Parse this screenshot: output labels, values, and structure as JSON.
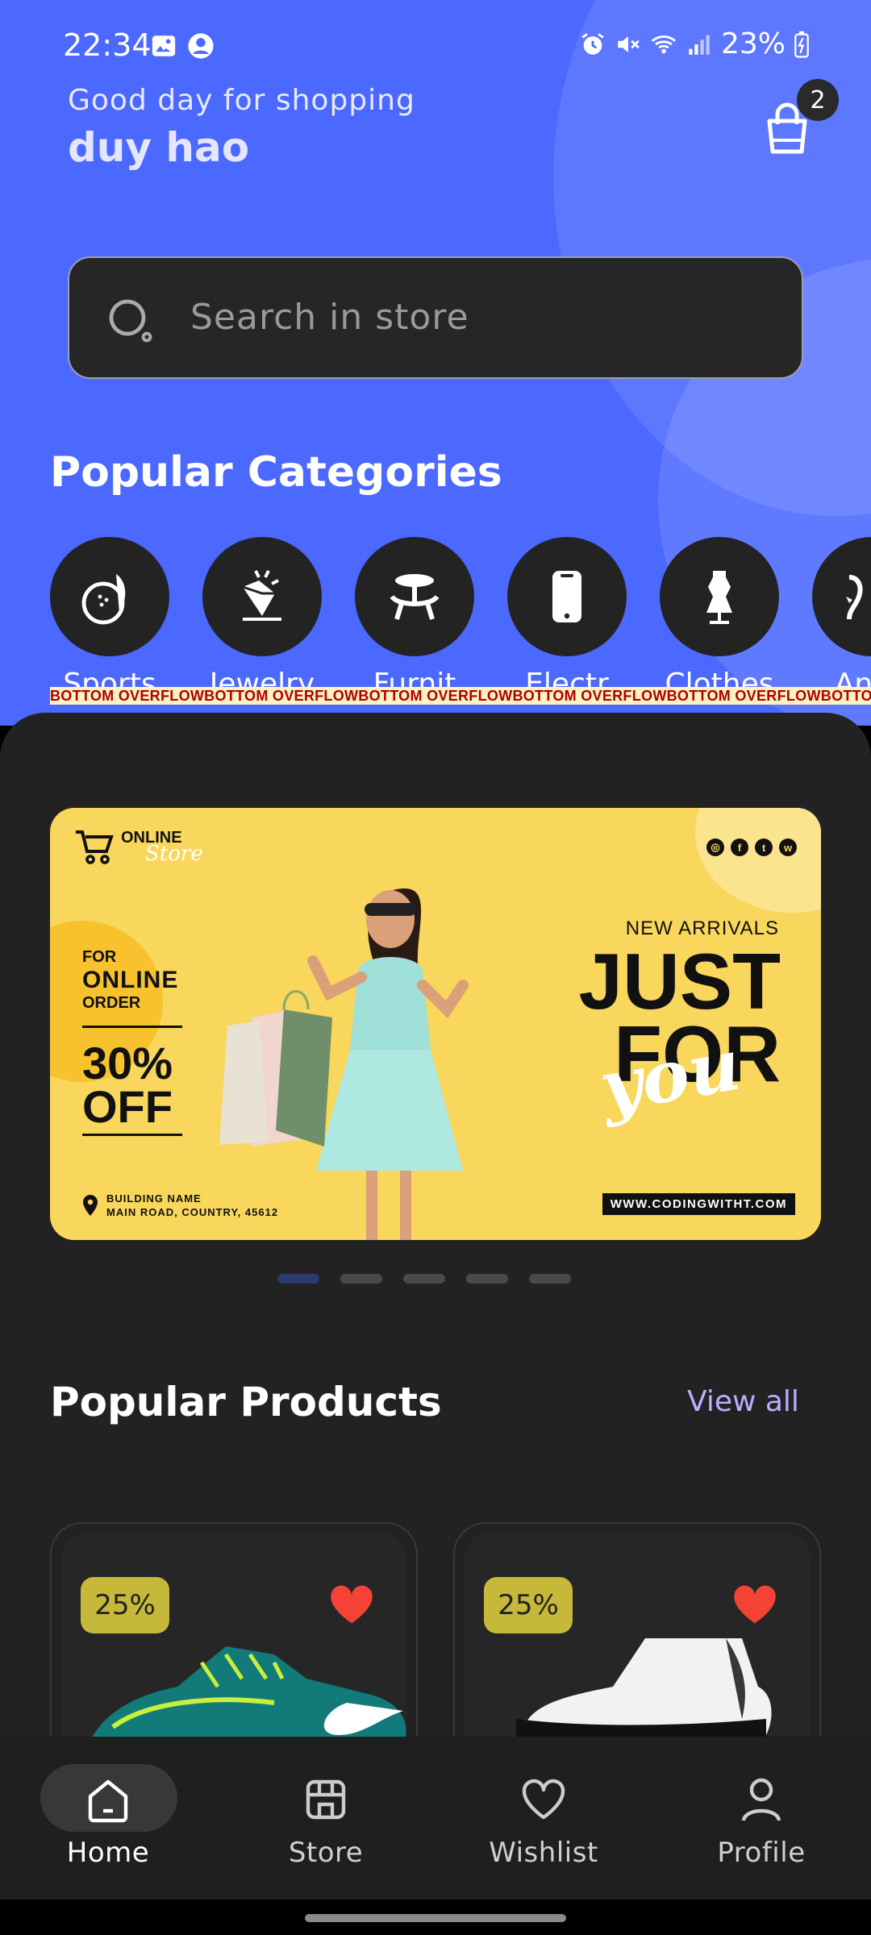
{
  "status_bar": {
    "time": "22:34",
    "battery": "23%"
  },
  "header": {
    "greeting": "Good day for shopping",
    "username": "duy hao",
    "cart_count": "2"
  },
  "search": {
    "placeholder": "Search in store"
  },
  "categories": {
    "title": "Popular Categories",
    "items": [
      {
        "label": "Sports",
        "icon": "sports-icon"
      },
      {
        "label": "Jewelry",
        "icon": "jewelry-icon"
      },
      {
        "label": "Furnit",
        "icon": "furniture-icon"
      },
      {
        "label": "Electr",
        "icon": "electronics-icon"
      },
      {
        "label": "Clothes",
        "icon": "clothes-icon"
      },
      {
        "label": "Anim",
        "icon": "animals-icon"
      }
    ],
    "overflow_warning": "BOTTOM OVERFLOWBOTTOM OVERFLOWBOTTOM OVERFLOWBOTTOM OVERFLOWBOTTOM OVERFLOWBOTTOM OVERFLOWBOTTOM OVERFLOW"
  },
  "banner": {
    "logo_line1": "ONLINE",
    "logo_line2": "Store",
    "for": "FOR",
    "online": "ONLINE",
    "order": "ORDER",
    "off_line1": "30%",
    "off_line2": "OFF",
    "address_line1": "BUILDING NAME",
    "address_line2": "MAIN ROAD, COUNTRY, 45612",
    "new_arrivals": "NEW ARRIVALS",
    "just": "JUST",
    "for_big": "FOR",
    "you": "you",
    "url": "WWW.CODINGWITHT.COM",
    "slide_count": 5,
    "active_slide": 0
  },
  "products": {
    "title": "Popular Products",
    "view_all": "View all",
    "items": [
      {
        "discount": "25%",
        "favorite": true,
        "image": "teal-running-shoes"
      },
      {
        "discount": "25%",
        "favorite": true,
        "image": "black-white-sneaker"
      }
    ]
  },
  "bottom_nav": {
    "items": [
      {
        "label": "Home",
        "icon": "home-icon",
        "active": true
      },
      {
        "label": "Store",
        "icon": "store-icon",
        "active": false
      },
      {
        "label": "Wishlist",
        "icon": "heart-icon",
        "active": false
      },
      {
        "label": "Profile",
        "icon": "profile-icon",
        "active": false
      }
    ]
  },
  "colors": {
    "primary_blue": "#4B68FF",
    "dark_bg": "#222222",
    "discount_badge": "#C6B93A",
    "heart": "#F44336",
    "view_all": "#B9AFFF"
  }
}
